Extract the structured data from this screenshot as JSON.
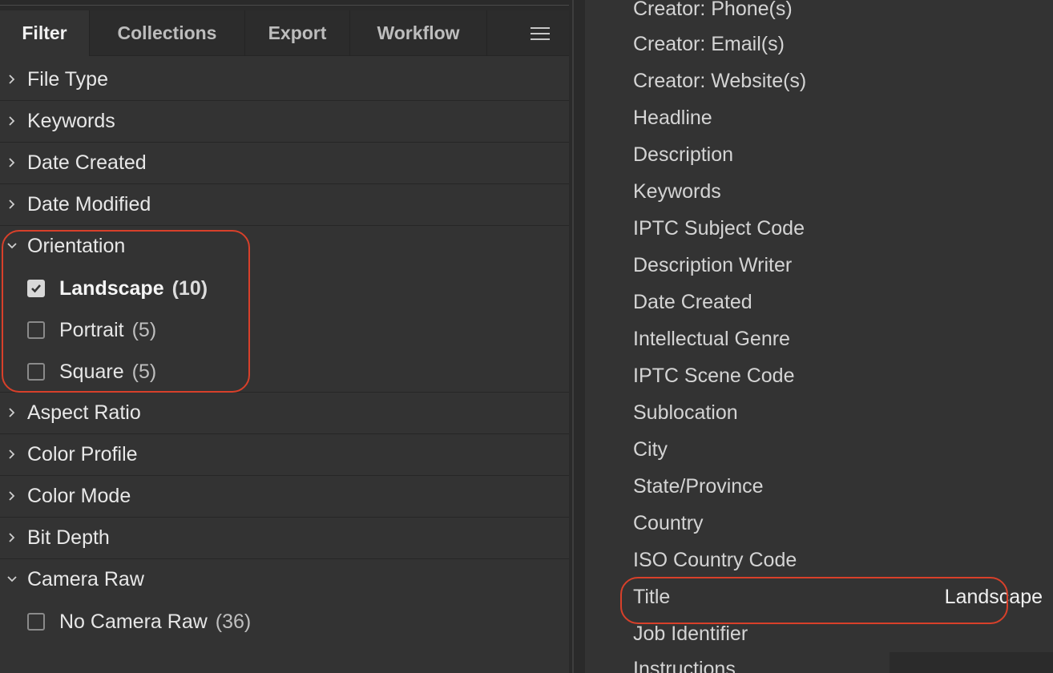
{
  "tabs": [
    {
      "label": "Filter",
      "active": true
    },
    {
      "label": "Collections",
      "active": false
    },
    {
      "label": "Export",
      "active": false
    },
    {
      "label": "Workflow",
      "active": false
    }
  ],
  "menu_icon": "hamburger-menu-icon",
  "filters": {
    "file_type": {
      "label": "File Type",
      "expanded": false
    },
    "keywords": {
      "label": "Keywords",
      "expanded": false
    },
    "date_created": {
      "label": "Date Created",
      "expanded": false
    },
    "date_modified": {
      "label": "Date Modified",
      "expanded": false
    },
    "orientation": {
      "label": "Orientation",
      "expanded": true,
      "options": [
        {
          "label": "Landscape",
          "count": "(10)",
          "checked": true
        },
        {
          "label": "Portrait",
          "count": "(5)",
          "checked": false
        },
        {
          "label": "Square",
          "count": "(5)",
          "checked": false
        }
      ]
    },
    "aspect_ratio": {
      "label": "Aspect Ratio",
      "expanded": false
    },
    "color_profile": {
      "label": "Color Profile",
      "expanded": false
    },
    "color_mode": {
      "label": "Color Mode",
      "expanded": false
    },
    "bit_depth": {
      "label": "Bit Depth",
      "expanded": false
    },
    "camera_raw": {
      "label": "Camera Raw",
      "expanded": true,
      "options": [
        {
          "label": "No Camera Raw",
          "count": "(36)",
          "checked": false
        }
      ]
    }
  },
  "metadata_fields": [
    {
      "label": "Creator: Phone(s)",
      "value": ""
    },
    {
      "label": "Creator: Email(s)",
      "value": ""
    },
    {
      "label": "Creator: Website(s)",
      "value": ""
    },
    {
      "label": "Headline",
      "value": ""
    },
    {
      "label": "Description",
      "value": ""
    },
    {
      "label": "Keywords",
      "value": ""
    },
    {
      "label": "IPTC Subject Code",
      "value": ""
    },
    {
      "label": "Description Writer",
      "value": ""
    },
    {
      "label": "Date Created",
      "value": ""
    },
    {
      "label": "Intellectual Genre",
      "value": ""
    },
    {
      "label": "IPTC Scene Code",
      "value": ""
    },
    {
      "label": "Sublocation",
      "value": ""
    },
    {
      "label": "City",
      "value": ""
    },
    {
      "label": "State/Province",
      "value": ""
    },
    {
      "label": "Country",
      "value": ""
    },
    {
      "label": "ISO Country Code",
      "value": ""
    },
    {
      "label": "Title",
      "value": "Landscape"
    },
    {
      "label": "Job Identifier",
      "value": ""
    },
    {
      "label": "Instructions",
      "value": ""
    }
  ],
  "colors": {
    "panel_bg": "#333333",
    "tab_bar_bg": "#2c2c2c",
    "callout_red": "#d8402a",
    "text": "#e6e6e6"
  }
}
